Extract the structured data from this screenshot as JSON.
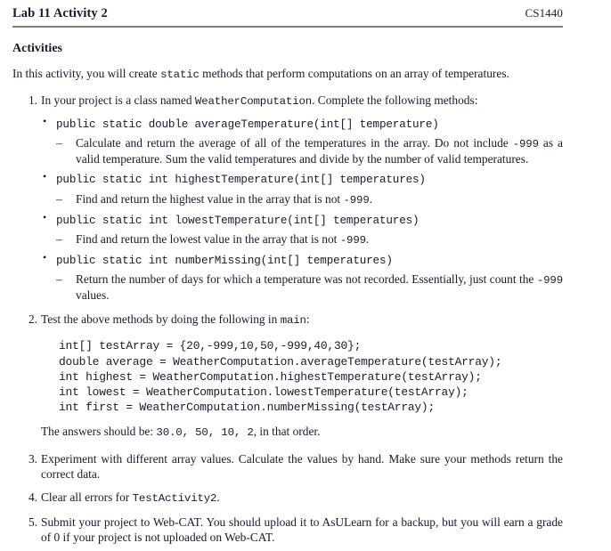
{
  "header": {
    "title": "Lab 11 Activity 2",
    "course": "CS1440"
  },
  "section": {
    "heading": "Activities",
    "intro_before": "In this activity, you will create ",
    "intro_code": "static",
    "intro_after": " methods that perform computations on an array of temperatures."
  },
  "items": {
    "one": {
      "number": "1.",
      "text_before": "In your project is a class named ",
      "class_name": "WeatherComputation",
      "text_after": ". Complete the following methods:",
      "methods": [
        {
          "signature": "public static double averageTemperature(int[] temperature)",
          "detail_parts": {
            "a": "Calculate and return the average of all of the temperatures in the array. Do not include ",
            "code1": "-999",
            "b": " as a valid temperature. Sum the valid temperatures and divide by the number of valid temperatures."
          }
        },
        {
          "signature": "public static int highestTemperature(int[] temperatures)",
          "detail_parts": {
            "a": "Find and return the highest value in the array that is not ",
            "code1": "-999",
            "b": "."
          }
        },
        {
          "signature": "public static int lowestTemperature(int[] temperatures)",
          "detail_parts": {
            "a": "Find and return the lowest value in the array that is not ",
            "code1": "-999",
            "b": "."
          }
        },
        {
          "signature": "public static int numberMissing(int[] temperatures)",
          "detail_parts": {
            "a": "Return the number of days for which a temperature was not recorded. Essentially, just count the ",
            "code1": "-999",
            "b": " values."
          }
        }
      ]
    },
    "two": {
      "number": "2.",
      "text_before": "Test the above methods by doing the following in ",
      "code": "main",
      "text_after": ":",
      "code_lines": [
        "int[] testArray = {20,-999,10,50,-999,40,30};",
        "double average = WeatherComputation.averageTemperature(testArray);",
        "int highest = WeatherComputation.highestTemperature(testArray);",
        "int lowest = WeatherComputation.lowestTemperature(testArray);",
        "int first = WeatherComputation.numberMissing(testArray);"
      ],
      "answers_before": "The answers should be: ",
      "answers_code": "30.0, 50, 10, 2",
      "answers_after": ", in that order."
    },
    "three": {
      "number": "3.",
      "text": "Experiment with different array values. Calculate the values by hand. Make sure your methods return the correct data."
    },
    "four": {
      "number": "4.",
      "text_before": "Clear all errors for ",
      "code": "TestActivity2",
      "text_after": "."
    },
    "five": {
      "number": "5.",
      "text": "Submit your project to Web-CAT. You should upload it to AsULearn for a backup, but you will earn a grade of 0 if your project is not uploaded on Web-CAT."
    }
  },
  "glyphs": {
    "bullet": "•",
    "dash": "–"
  },
  "colors": {
    "text": "#1a1a2e",
    "rule": "#7f7f7f"
  }
}
